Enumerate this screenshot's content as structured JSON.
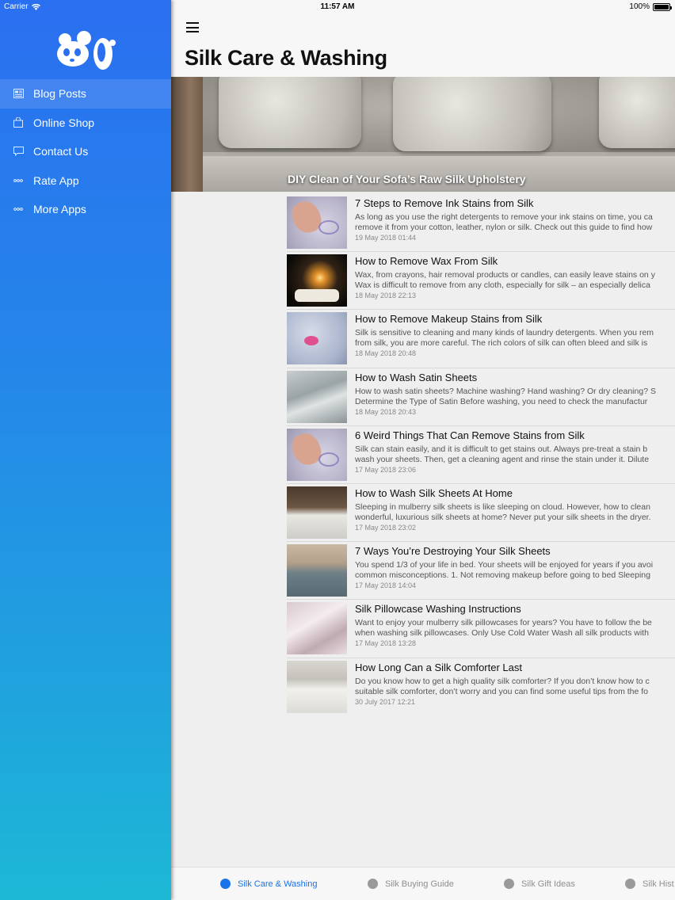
{
  "status_bar": {
    "carrier": "Carrier",
    "time": "11:57 AM",
    "battery": "100%"
  },
  "sidebar": {
    "items": [
      {
        "label": "Blog Posts",
        "icon": "newspaper-icon",
        "active": true
      },
      {
        "label": "Online Shop",
        "icon": "shopping-bag-icon",
        "active": false
      },
      {
        "label": "Contact Us",
        "icon": "chat-bubble-icon",
        "active": false
      },
      {
        "label": "Rate App",
        "icon": "more-dots-icon",
        "active": false
      },
      {
        "label": "More Apps",
        "icon": "more-dots-icon",
        "active": false
      }
    ]
  },
  "header": {
    "title": "Silk Care & Washing"
  },
  "hero": {
    "caption": "DIY Clean of Your Sofa’s Raw Silk Upholstery"
  },
  "posts": [
    {
      "title": "7 Steps to Remove Ink Stains from Silk",
      "line1": "As long as you use the right detergents to remove your ink stains on time, you ca",
      "line2": "remove it from your cotton, leather, nylon or silk. Check out this guide to find how",
      "date": "19 May 2018 01:44"
    },
    {
      "title": "How to Remove Wax From Silk",
      "line1": "Wax, from crayons, hair removal products or candles, can easily leave stains on y",
      "line2": "Wax is difficult to remove from any cloth, especially for silk – an especially delica",
      "date": "18 May 2018 22:13"
    },
    {
      "title": "How to Remove Makeup Stains from Silk",
      "line1": "Silk is sensitive to cleaning and many kinds of laundry detergents. When you rem",
      "line2": "from silk, you are more careful. The rich colors of silk can often bleed and silk is",
      "date": "18 May 2018 20:48"
    },
    {
      "title": "How to Wash Satin Sheets",
      "line1": "How to wash satin sheets? Machine washing? Hand washing? Or dry cleaning?  S",
      "line2": "Determine the Type of Satin  Before washing, you need to check the manufactur",
      "date": "18 May 2018 20:43"
    },
    {
      "title": "6 Weird Things That Can Remove Stains from Silk",
      "line1": "Silk can stain easily, and it is difficult to get stains out.  Always pre-treat a stain b",
      "line2": "wash your sheets. Then, get a cleaning agent and rinse the stain under it.   Dilute",
      "date": "17 May 2018 23:06"
    },
    {
      "title": "How to Wash Silk Sheets At Home",
      "line1": "Sleeping in mulberry silk sheets is like sleeping on cloud. However, how to clean",
      "line2": "wonderful, luxurious silk sheets at home? Never put your silk sheets in the dryer.",
      "date": "17 May 2018 23:02"
    },
    {
      "title": "7 Ways You’re Destroying Your Silk Sheets",
      "line1": "You spend 1/3 of your life in bed. Your sheets will be enjoyed for years if you avoi",
      "line2": "common misconceptions.  1. Not removing makeup before going to bed  Sleeping",
      "date": "17 May 2018 14:04"
    },
    {
      "title": "Silk Pillowcase Washing Instructions",
      "line1": "Want to enjoy your mulberry silk pillowcases for years? You have to follow the be",
      "line2": "when washing silk pillowcases.  Only Use Cold Water  Wash all silk products with",
      "date": "17 May 2018 13:28"
    },
    {
      "title": "How Long Can a Silk Comforter Last",
      "line1": "Do you know how to get a high quality silk comforter? If you don’t know how to c",
      "line2": "suitable silk comforter, don’t worry and you can find some useful tips from the fo",
      "date": "30 July 2017 12:21"
    }
  ],
  "tabs": [
    {
      "label": "Silk Care & Washing",
      "active": true
    },
    {
      "label": "Silk Buying Guide",
      "active": false
    },
    {
      "label": "Silk Gift Ideas",
      "active": false
    },
    {
      "label": "Silk Hist",
      "active": false
    }
  ],
  "colors": {
    "accent": "#1a73e8",
    "sidebar_top": "#2a6ff0",
    "sidebar_bottom": "#1db8d6"
  }
}
